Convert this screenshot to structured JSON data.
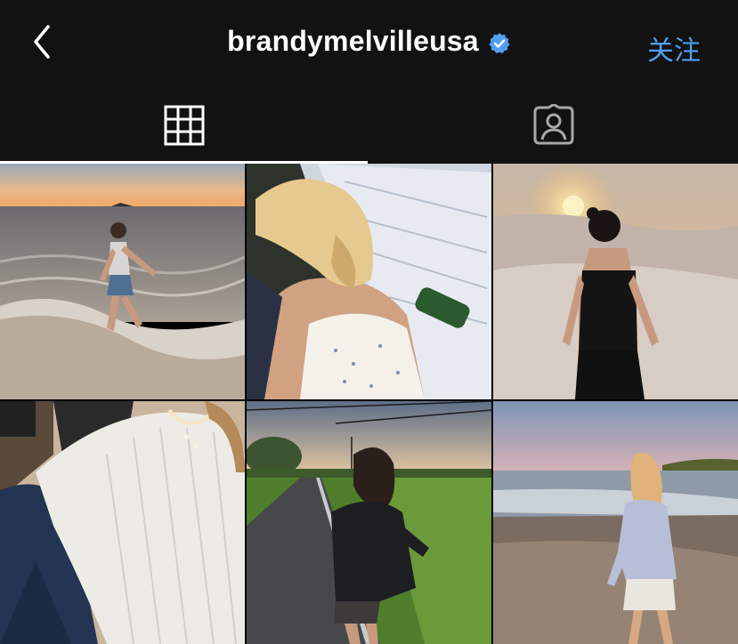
{
  "header": {
    "title": "brandymelvilleusa",
    "follow_label": "关注",
    "verified_icon": "verified-badge-icon",
    "back_icon": "chevron-left-icon"
  },
  "tabs": [
    {
      "name": "grid",
      "icon": "grid-icon",
      "active": true
    },
    {
      "name": "tagged",
      "icon": "tagged-person-icon",
      "active": false
    }
  ],
  "colors": {
    "accent": "#4f9ff0",
    "header_bg": "#121212",
    "text": "#ffffff"
  },
  "posts": [
    {
      "id": 1,
      "scene": "beach-sunset-wading"
    },
    {
      "id": 2,
      "scene": "blonde-ponytail-picnic"
    },
    {
      "id": 3,
      "scene": "desert-dunes-sunset"
    },
    {
      "id": 4,
      "scene": "white-knit-cardigan-jeans"
    },
    {
      "id": 5,
      "scene": "country-road-hoodie"
    },
    {
      "id": 6,
      "scene": "beach-evening-cardigan"
    }
  ]
}
